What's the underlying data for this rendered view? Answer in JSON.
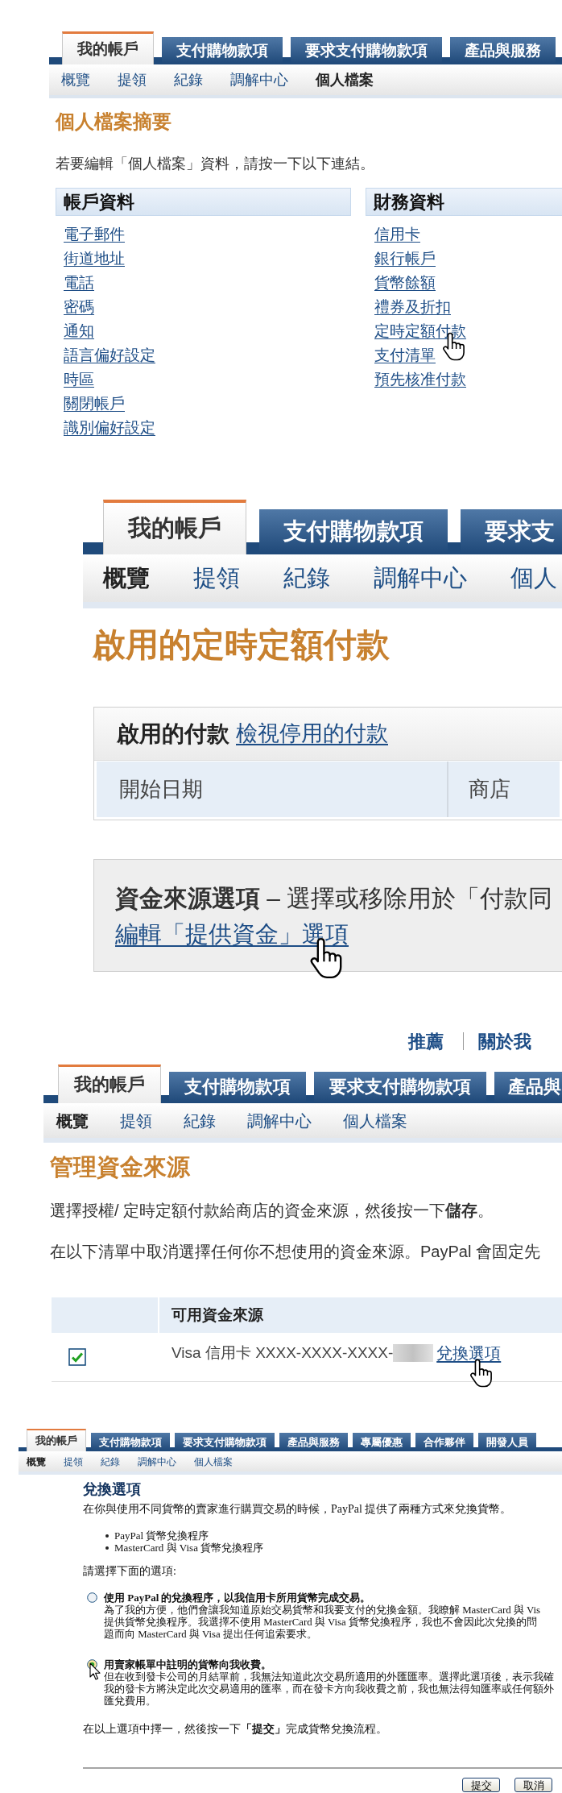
{
  "profile_summary": {
    "tabs": [
      {
        "label": "我的帳戶",
        "selected": true
      },
      {
        "label": "支付購物款項",
        "selected": false
      },
      {
        "label": "要求支付購物款項",
        "selected": false
      },
      {
        "label": "產品與服務",
        "selected": false
      }
    ],
    "subnav": [
      {
        "label": "概覽",
        "selected": false
      },
      {
        "label": "提領",
        "selected": false
      },
      {
        "label": "紀錄",
        "selected": false
      },
      {
        "label": "調解中心",
        "selected": false
      },
      {
        "label": "個人檔案",
        "selected": true
      }
    ],
    "title": "個人檔案摘要",
    "intro": "若要編輯「個人檔案」資料，請按一下以下連結。",
    "sections": [
      {
        "heading": "帳戶資料",
        "links": [
          "電子郵件",
          "街道地址",
          "電話",
          "密碼",
          "通知",
          "語言偏好設定",
          "時區",
          "關閉帳戶",
          "識別偏好設定"
        ]
      },
      {
        "heading": "財務資料",
        "links": [
          "信用卡",
          "銀行帳戶",
          "貨幣餘額",
          "禮券及折扣",
          "定時定額付款",
          "支付清單",
          "預先核准付款"
        ]
      }
    ]
  },
  "recurring_payments": {
    "tabs": [
      {
        "label": "我的帳戶",
        "selected": true
      },
      {
        "label": "支付購物款項",
        "selected": false
      },
      {
        "label": "要求支",
        "selected": false
      }
    ],
    "subnav": [
      {
        "label": "概覽",
        "selected": true
      },
      {
        "label": "提領",
        "selected": false
      },
      {
        "label": "紀錄",
        "selected": false
      },
      {
        "label": "調解中心",
        "selected": false
      },
      {
        "label": "個人",
        "selected": false
      }
    ],
    "title": "啟用的定時定額付款",
    "payments_table": {
      "heading": "啟用的付款",
      "link": "檢視停用的付款",
      "columns": [
        "開始日期",
        "商店"
      ]
    },
    "funding_box": {
      "text": "**資金來源選項** – 選擇或移除用於「付款同",
      "link": "編輯「提供資金」選項"
    }
  },
  "funding_sources": {
    "top_links": [
      "推薦",
      "關於我"
    ],
    "tabs": [
      {
        "label": "我的帳戶",
        "selected": true
      },
      {
        "label": "支付購物款項",
        "selected": false
      },
      {
        "label": "要求支付購物款項",
        "selected": false
      },
      {
        "label": "產品與",
        "selected": false
      }
    ],
    "subnav": [
      {
        "label": "概覽",
        "selected": true
      },
      {
        "label": "提領",
        "selected": false
      },
      {
        "label": "紀錄",
        "selected": false
      },
      {
        "label": "調解中心",
        "selected": false
      },
      {
        "label": "個人檔案",
        "selected": false
      }
    ],
    "title": "管理資金來源",
    "paragraphs": [
      "選擇授權/ 定時定額付款給商店的資金來源，然後按一下**儲存**。",
      "在以下清單中取消選擇任何你不想使用的資金來源。PayPal 會固定先"
    ],
    "sources_table": {
      "column": "可用資金來源",
      "rows": [
        {
          "checked": true,
          "source": "Visa 信用卡 XXXX-XXXX-XXXX-",
          "link": "兌換選項"
        }
      ]
    }
  },
  "conversion_options": {
    "tabs": [
      {
        "label": "我的帳戶",
        "selected": true
      },
      {
        "label": "支付購物款項",
        "selected": false
      },
      {
        "label": "要求支付購物款項",
        "selected": false
      },
      {
        "label": "產品與服務",
        "selected": false
      },
      {
        "label": "專屬優惠",
        "selected": false
      },
      {
        "label": "合作夥伴",
        "selected": false
      },
      {
        "label": "開發人員",
        "selected": false
      }
    ],
    "subnav": [
      {
        "label": "概覽",
        "selected": true
      },
      {
        "label": "提領",
        "selected": false
      },
      {
        "label": "紀錄",
        "selected": false
      },
      {
        "label": "調解中心",
        "selected": false
      },
      {
        "label": "個人檔案",
        "selected": false
      }
    ],
    "title": "兌換選項",
    "intro": "在你與使用不同貨幣的賣家進行購買交易的時候，PayPal 提供了兩種方式來兌換貨幣。",
    "bullets": [
      "PayPal 貨幣兌換程序",
      "MasterCard 與 Visa 貨幣兌換程序"
    ],
    "prompt": "請選擇下面的選項:",
    "options": [
      {
        "selected": false,
        "label": "使用 PayPal 的兌換程序，以我信用卡所用貨幣完成交易。",
        "description": [
          "為了我的方便，他們會讓我知道原始交易貨幣和我要支付的兌換金額。我瞭解 MasterCard 與 Vis",
          "提供貨幣兌換程序。我選擇不使用 MasterCard 與 Visa 貨幣兌換程序，我也不會因此次兌換的問",
          "題而向 MasterCard 與 Visa 提出任何追索要求。"
        ]
      },
      {
        "selected": true,
        "label": "用賣家帳單中註明的貨幣向我收費。",
        "description": [
          "但在收到發卡公司的月結單前，我無法知道此次交易所適用的外匯匯率。選擇此選項後，表示我確",
          "我的發卡方將決定此次交易適用的匯率，而在發卡方向我收費之前，我也無法得知匯率或任何額外",
          "匯兌費用。"
        ]
      }
    ],
    "instruction": "在以上選項中擇一，然後按一下**「提交」**完成貨幣兌換流程。",
    "buttons": [
      "提交",
      "取消"
    ]
  }
}
